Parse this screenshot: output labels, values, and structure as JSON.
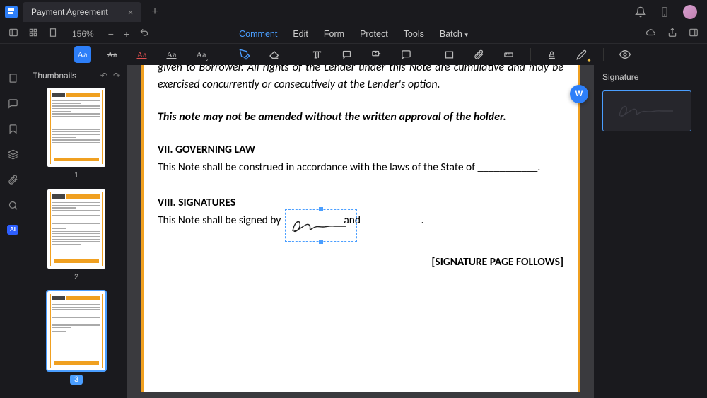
{
  "tab": {
    "title": "Payment Agreement"
  },
  "toolbar": {
    "zoom": "156%"
  },
  "menu": {
    "comment": "Comment",
    "edit": "Edit",
    "form": "Form",
    "protect": "Protect",
    "tools": "Tools",
    "batch": "Batch"
  },
  "thumbnails": {
    "title": "Thumbnails",
    "pages": [
      "1",
      "2",
      "3"
    ]
  },
  "document": {
    "para_top": "given to Borrower. All rights of the Lender under this Note are cumulative and may be exercised concurrently or consecutively at the Lender's option.",
    "amend": "This note may not be amended without the written approval of the holder.",
    "h7": "VII. GOVERNING LAW",
    "law": "This Note shall be construed in accordance with the laws of the State of ___________.",
    "h8": "VIII. SIGNATURES",
    "sign_pre": "This Note shall be signed by ",
    "sign_mid": " and ",
    "sign_end": ".",
    "follows": "[SIGNATURE PAGE FOLLOWS]"
  },
  "rightpanel": {
    "title": "Signature"
  },
  "ai": "AI",
  "word_badge": "W"
}
